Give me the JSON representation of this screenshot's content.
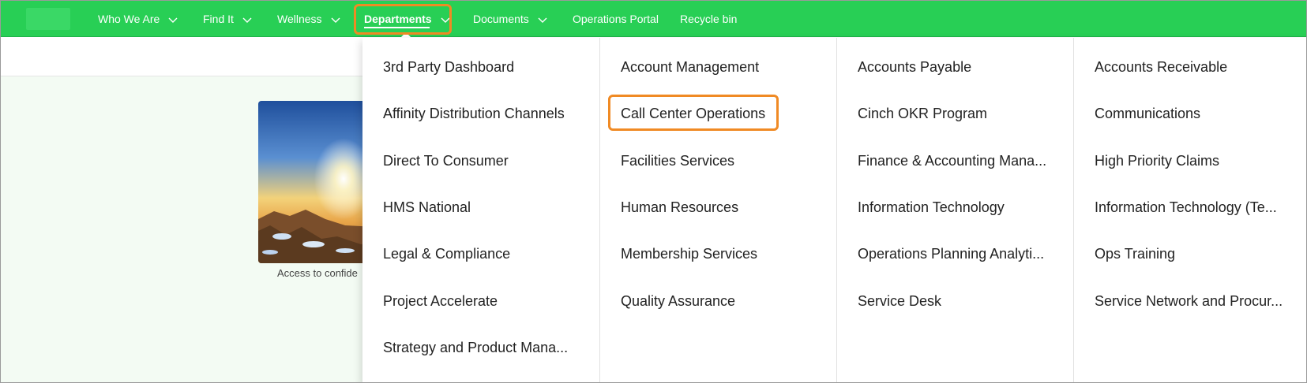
{
  "nav": {
    "items": [
      {
        "label": "Who We Are",
        "has_chevron": true
      },
      {
        "label": "Find It",
        "has_chevron": true
      },
      {
        "label": "Wellness",
        "has_chevron": true
      },
      {
        "label": "Departments",
        "has_chevron": true,
        "active": true
      },
      {
        "label": "Documents",
        "has_chevron": true
      },
      {
        "label": "Operations Portal",
        "has_chevron": false
      },
      {
        "label": "Recycle bin",
        "has_chevron": false
      }
    ]
  },
  "hero": {
    "caption": "Access to confide"
  },
  "departments": {
    "columns": [
      [
        "3rd Party Dashboard",
        "Affinity Distribution Channels",
        "Direct To Consumer",
        "HMS National",
        "Legal & Compliance",
        "Project Accelerate",
        "Strategy and Product Mana..."
      ],
      [
        "Account Management",
        "Call Center Operations",
        "Facilities Services",
        "Human Resources",
        "Membership Services",
        "Quality Assurance"
      ],
      [
        "Accounts Payable",
        "Cinch OKR Program",
        "Finance & Accounting Mana...",
        "Information Technology",
        "Operations Planning Analyti...",
        "Service Desk"
      ],
      [
        "Accounts Receivable",
        "Communications",
        "High Priority Claims",
        "Information Technology (Te...",
        "Ops Training",
        "Service Network and Procur..."
      ]
    ],
    "highlighted": "Call Center Operations"
  },
  "colors": {
    "nav_bg": "#28cf55",
    "highlight": "#f08a24",
    "content_bg": "#f3fbf3"
  }
}
